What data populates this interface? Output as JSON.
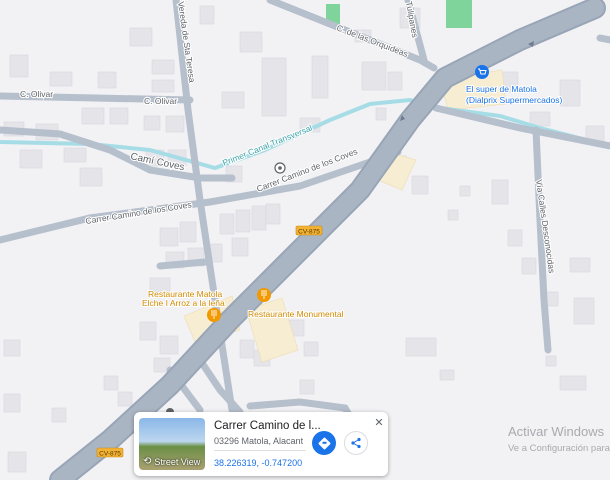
{
  "streets": {
    "vereda_sta_teresa": "Vereda de Sta Teresa",
    "orquideas": "C. de las Orquídeas",
    "tulipanes": "Tulipanes",
    "olivar_1": "C. Olivar",
    "olivar_2": "C. Olivar",
    "cami_coves": "Camí Coves",
    "canal": "Primer Canal Transversal",
    "camino_coves_1": "Carrer Camino de los Coves",
    "camino_coves_2": "Carrer Camino de los Coves",
    "calles_desconocidas": "Vía Calles Desconocidas"
  },
  "road_shields": {
    "cv_upper": "CV-875",
    "cv_lower": "CV-875"
  },
  "pois": {
    "supermarket_line1": "El super de Matola",
    "supermarket_line2": "(Dialprix Supermercados)",
    "restaurant_matola_line1": "Restaurante Matola",
    "restaurant_matola_line2": "Elche I Arroz a la leña",
    "restaurant_monumental": "Restaurante Monumental"
  },
  "icons": {
    "supermarket": "shopping-cart-icon",
    "restaurant": "fork-knife-icon",
    "location": "dropped-pin-icon",
    "directions": "directions-icon",
    "share": "share-icon",
    "close": "close-icon"
  },
  "info_card": {
    "title": "Carrer Camino de l...",
    "address": "03296 Matola, Alacant",
    "coordinates": "38.226319, -0.747200",
    "street_view_label": "Street View"
  },
  "watermark": {
    "line1": "Activar Windows",
    "line2": "Ve a Configuración para"
  },
  "colors": {
    "background": "#f2f2f4",
    "road": "#aab5c4",
    "road_outline": "#98a5b6",
    "canal": "#a6dce6",
    "building": "#e6e6ea",
    "poi_area": "#f7edd2",
    "park": "#7ed49b",
    "poi_label": "#d18a00",
    "shop_label": "#1a73e8",
    "shield": "#f3b233",
    "accent_blue": "#1a73e8"
  }
}
